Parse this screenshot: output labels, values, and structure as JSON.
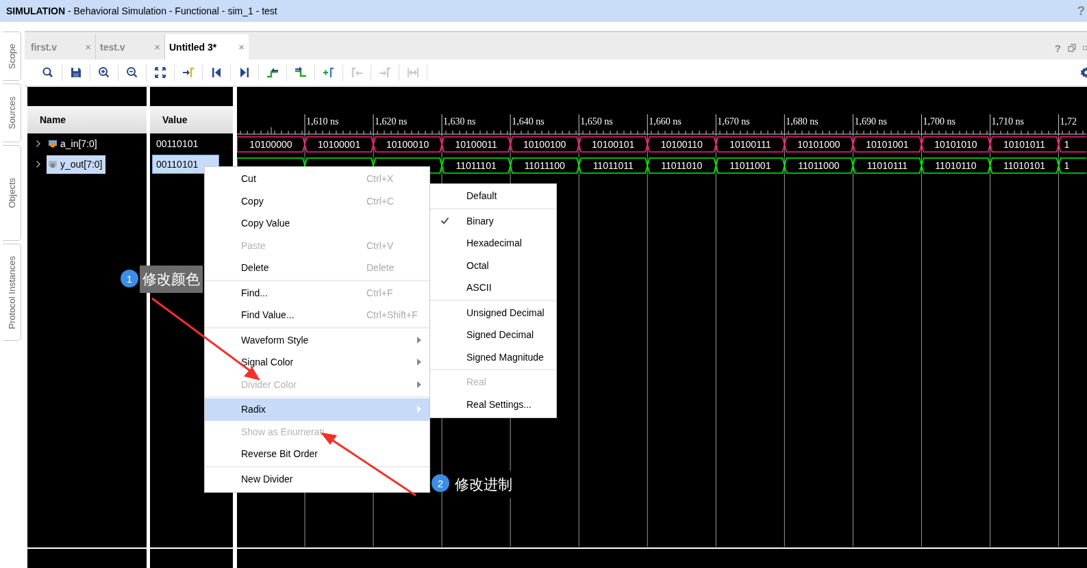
{
  "title": "**SIMULATION** - Behavioral Simulation - Functional - sim_1 - test",
  "title_help": "?",
  "side_tabs": [
    "Scope",
    "Sources",
    "Objects",
    "Protocol Instances"
  ],
  "tabs": [
    {
      "label": "first.v",
      "close": "×",
      "selected": false
    },
    {
      "label": "test.v",
      "close": "×",
      "selected": false
    },
    {
      "label": "Untitled 3*",
      "close": "×",
      "selected": true
    }
  ],
  "tab_help": "?",
  "toolbar": [
    {
      "kind": "search",
      "disabled": false
    },
    {
      "kind": "save",
      "disabled": false
    },
    {
      "kind": "zoom-in",
      "disabled": false
    },
    {
      "kind": "zoom-out",
      "disabled": false
    },
    {
      "kind": "fit",
      "disabled": false
    },
    {
      "kind": "goto-marker",
      "disabled": false
    },
    {
      "kind": "go-start",
      "disabled": false
    },
    {
      "kind": "go-end",
      "disabled": false
    },
    {
      "kind": "prev-transition",
      "disabled": false
    },
    {
      "kind": "next-transition",
      "disabled": false
    },
    {
      "kind": "add-marker",
      "disabled": false
    },
    {
      "kind": "prev-marker",
      "disabled": true
    },
    {
      "kind": "next-marker",
      "disabled": true
    },
    {
      "kind": "swap-markers",
      "disabled": true
    }
  ],
  "columns": [
    "Name",
    "Value"
  ],
  "time_labels": [
    "1,610 ns",
    "1,620 ns",
    "1,630 ns",
    "1,640 ns",
    "1,650 ns",
    "1,660 ns",
    "1,670 ns",
    "1,680 ns",
    "1,690 ns",
    "1,700 ns",
    "1,710 ns",
    "1,72"
  ],
  "signals": [
    {
      "name": "a_in[7:0]",
      "kind": "input",
      "value": "00110101",
      "selected": false,
      "color": "#ff1f7f",
      "segments": [
        "10100000",
        "10100001",
        "10100010",
        "10100011",
        "10100100",
        "10100101",
        "10100110",
        "10100111",
        "10101000",
        "10101001",
        "10101010",
        "10101011",
        "1"
      ]
    },
    {
      "name": "y_out[7:0]",
      "kind": "output",
      "value": "00110101",
      "selected": true,
      "color": "#00f000",
      "segments": [
        "11011101",
        "11011100",
        "11011011",
        "11011010",
        "11011001",
        "11011000",
        "11010111",
        "11010110",
        "11010101",
        "1"
      ]
    }
  ],
  "context_menu": {
    "groups": [
      [
        {
          "label": "Cut",
          "shortcut": "Ctrl+X",
          "disabled": false,
          "submenu": false,
          "selected": false
        },
        {
          "label": "Copy",
          "shortcut": "Ctrl+C",
          "disabled": false,
          "submenu": false,
          "selected": false
        },
        {
          "label": "Copy Value",
          "disabled": false,
          "submenu": false,
          "selected": false
        },
        {
          "label": "Paste",
          "shortcut": "Ctrl+V",
          "disabled": true,
          "submenu": false,
          "selected": false
        },
        {
          "label": "Delete",
          "shortcut": "Delete",
          "disabled": false,
          "submenu": false,
          "selected": false
        }
      ],
      [
        {
          "label": "Find...",
          "shortcut": "Ctrl+F",
          "disabled": false,
          "submenu": false,
          "selected": false
        },
        {
          "label": "Find Value...",
          "shortcut": "Ctrl+Shift+F",
          "disabled": false,
          "submenu": false,
          "selected": false
        }
      ],
      [
        {
          "label": "Waveform Style",
          "disabled": false,
          "submenu": true,
          "selected": false
        },
        {
          "label": "Signal Color",
          "disabled": false,
          "submenu": true,
          "selected": false
        },
        {
          "label": "Divider Color",
          "disabled": true,
          "submenu": true,
          "selected": false
        }
      ],
      [
        {
          "label": "Radix",
          "disabled": false,
          "submenu": true,
          "selected": true
        },
        {
          "label": "Show as Enumerati",
          "disabled": true,
          "submenu": false,
          "selected": false
        },
        {
          "label": "Reverse Bit Order",
          "disabled": false,
          "submenu": false,
          "selected": false
        }
      ],
      [
        {
          "label": "New Divider",
          "disabled": false,
          "submenu": false,
          "selected": false
        }
      ]
    ]
  },
  "radix_menu": {
    "groups": [
      [
        {
          "label": "Default",
          "checked": false,
          "disabled": false
        }
      ],
      [
        {
          "label": "Binary",
          "checked": true,
          "disabled": false
        },
        {
          "label": "Hexadecimal",
          "checked": false,
          "disabled": false
        },
        {
          "label": "Octal",
          "checked": false,
          "disabled": false
        },
        {
          "label": "ASCII",
          "checked": false,
          "disabled": false
        }
      ],
      [
        {
          "label": "Unsigned Decimal",
          "checked": false,
          "disabled": false
        },
        {
          "label": "Signed Decimal",
          "checked": false,
          "disabled": false
        },
        {
          "label": "Signed Magnitude",
          "checked": false,
          "disabled": false
        }
      ],
      [
        {
          "label": "Real",
          "checked": false,
          "disabled": true
        },
        {
          "label": "Real Settings...",
          "checked": false,
          "disabled": false
        }
      ]
    ]
  },
  "annotations": [
    {
      "number": "1",
      "text": "修改颜色"
    },
    {
      "number": "2",
      "text": "修改进制"
    }
  ]
}
